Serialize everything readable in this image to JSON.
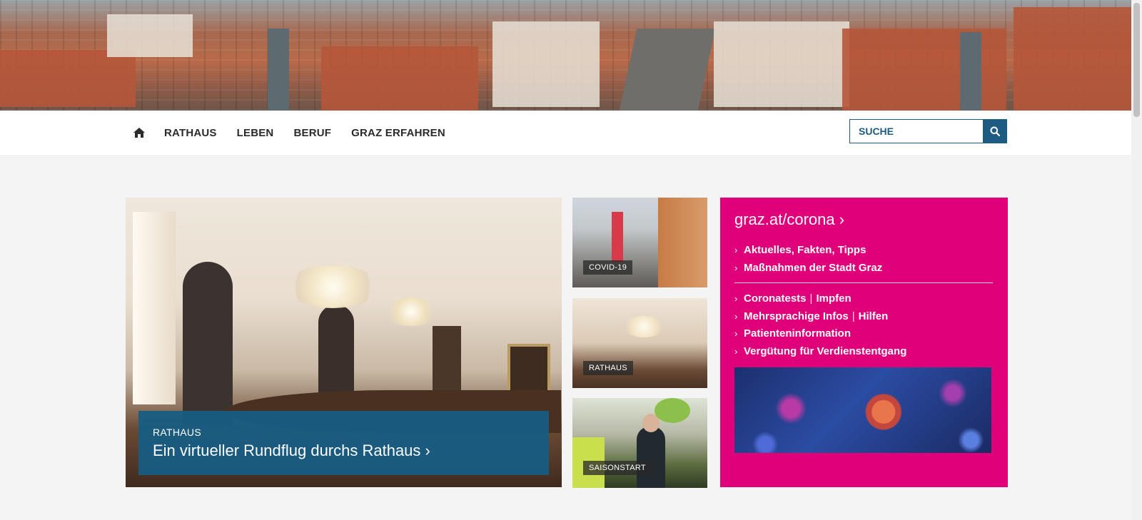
{
  "nav": {
    "home_icon": "home-icon",
    "items": [
      "RATHAUS",
      "LEBEN",
      "BERUF",
      "GRAZ ERFAHREN"
    ]
  },
  "search": {
    "placeholder": "SUCHE",
    "icon": "search-icon"
  },
  "hero": {
    "kicker": "RATHAUS",
    "title": "Ein virtueller Rundflug durchs Rathaus ›"
  },
  "thumbs": [
    {
      "label": "COVID-19"
    },
    {
      "label": "RATHAUS"
    },
    {
      "label": "SAISONSTART"
    }
  ],
  "corona": {
    "title": "graz.at/corona ›",
    "links_top": [
      "Aktuelles, Fakten, Tipps",
      "Maßnahmen der Stadt Graz"
    ],
    "links_bottom": [
      {
        "a": "Coronatests",
        "b": "Impfen"
      },
      {
        "a": "Mehrsprachige Infos",
        "b": "Hilfen"
      },
      {
        "a": "Patienteninformation"
      },
      {
        "a": "Vergütung für Verdienstentgang"
      }
    ],
    "separator": "|",
    "chevron": "›"
  },
  "colors": {
    "accent_blue": "#1e5b82",
    "corona_pink": "#e0007a",
    "hero_caption": "#165c84"
  }
}
